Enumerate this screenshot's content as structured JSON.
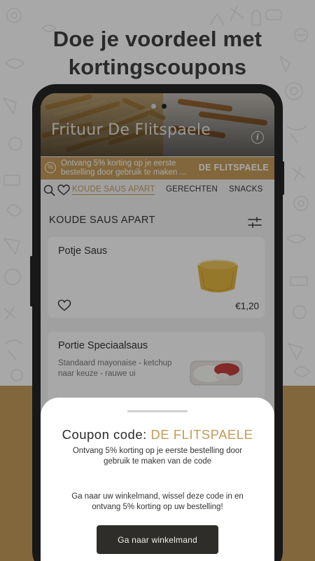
{
  "headline": {
    "line1": "Doe je voordeel met",
    "line2": "kortingscoupons"
  },
  "restaurant": {
    "name": "Frituur De Flitspaele"
  },
  "promo_banner": {
    "icon": "percent-icon",
    "text": "Ontvang 5% korting op je eerste bestelling door gebruik te maken ...",
    "code": "DE FLITSPAELE"
  },
  "tabs": [
    "KOUDE SAUS APART",
    "GERECHTEN",
    "SNACKS"
  ],
  "active_tab": "KOUDE SAUS APART",
  "section": {
    "title": "KOUDE SAUS APART"
  },
  "products": [
    {
      "name": "Potje Saus",
      "description": "",
      "price": "€1,20"
    },
    {
      "name": "Portie Speciaalsaus",
      "description": "Standaard mayonaise - ketchup naar keuze - rauwe ui",
      "price": ""
    }
  ],
  "coupon_sheet": {
    "label": "Coupon code:",
    "code": "DE FLITSPAELE",
    "description": "Ontvang 5% korting op je eerste bestelling door gebruik te maken van de code",
    "instruction": "Ga naar uw winkelmand, wissel deze code in en ontvang 5% korting op uw bestelling!",
    "button": "Ga naar winkelmand"
  },
  "colors": {
    "accent": "#c49a57",
    "dark_button": "#2f2d2a",
    "phone_frame": "#1e1e1e"
  }
}
